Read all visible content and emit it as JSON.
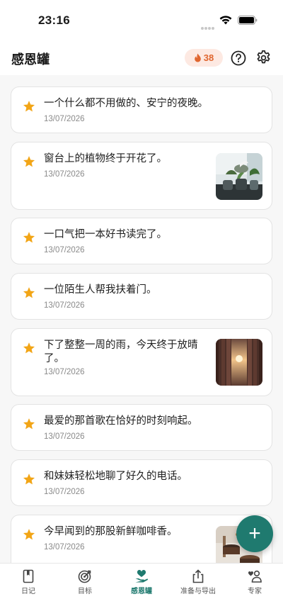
{
  "status_bar": {
    "time": "23:16"
  },
  "header": {
    "title": "感恩罐",
    "streak": "38"
  },
  "entries": [
    {
      "text": "一个什么都不用做的、安宁的夜晚。",
      "date": "13/07/2026"
    },
    {
      "text": "窗台上的植物终于开花了。",
      "date": "13/07/2026",
      "photo": "plant-photo"
    },
    {
      "text": "一口气把一本好书读完了。",
      "date": "13/07/2026"
    },
    {
      "text": "一位陌生人帮我扶着门。",
      "date": "13/07/2026"
    },
    {
      "text": "下了整整一周的雨，今天终于放晴了。",
      "date": "13/07/2026",
      "photo": "sunset-curtain-photo"
    },
    {
      "text": "最爱的那首歌在恰好的时刻响起。",
      "date": "13/07/2026"
    },
    {
      "text": "和妹妹轻松地聊了好久的电话。",
      "date": "13/07/2026"
    },
    {
      "text": "今早闻到的那股新鲜咖啡香。",
      "date": "13/07/2026",
      "photo": "coffee-photo"
    }
  ],
  "fab": {
    "label": "+"
  },
  "tabs": [
    {
      "label": "日记",
      "icon": "journal-icon",
      "active": false
    },
    {
      "label": "目标",
      "icon": "target-icon",
      "active": false
    },
    {
      "label": "感恩罐",
      "icon": "heart-hand-icon",
      "active": true
    },
    {
      "label": "准备与导出",
      "icon": "share-icon",
      "active": false
    },
    {
      "label": "专家",
      "icon": "expert-icon",
      "active": false
    }
  ],
  "colors": {
    "accent": "#1f7a6f",
    "star": "#f2a516",
    "streak": "#e0662f",
    "streak_bg": "#fde9e2"
  }
}
